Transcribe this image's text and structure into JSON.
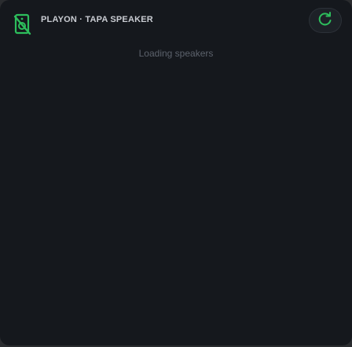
{
  "app": {
    "title": "PLAYON · TAPA SPEAKER",
    "logo_icon": "speaker-muted-icon",
    "accent_color": "#2dbe5c"
  },
  "header": {
    "refresh_icon": "refresh-icon"
  },
  "main": {
    "status_text": "Loading speakers"
  }
}
